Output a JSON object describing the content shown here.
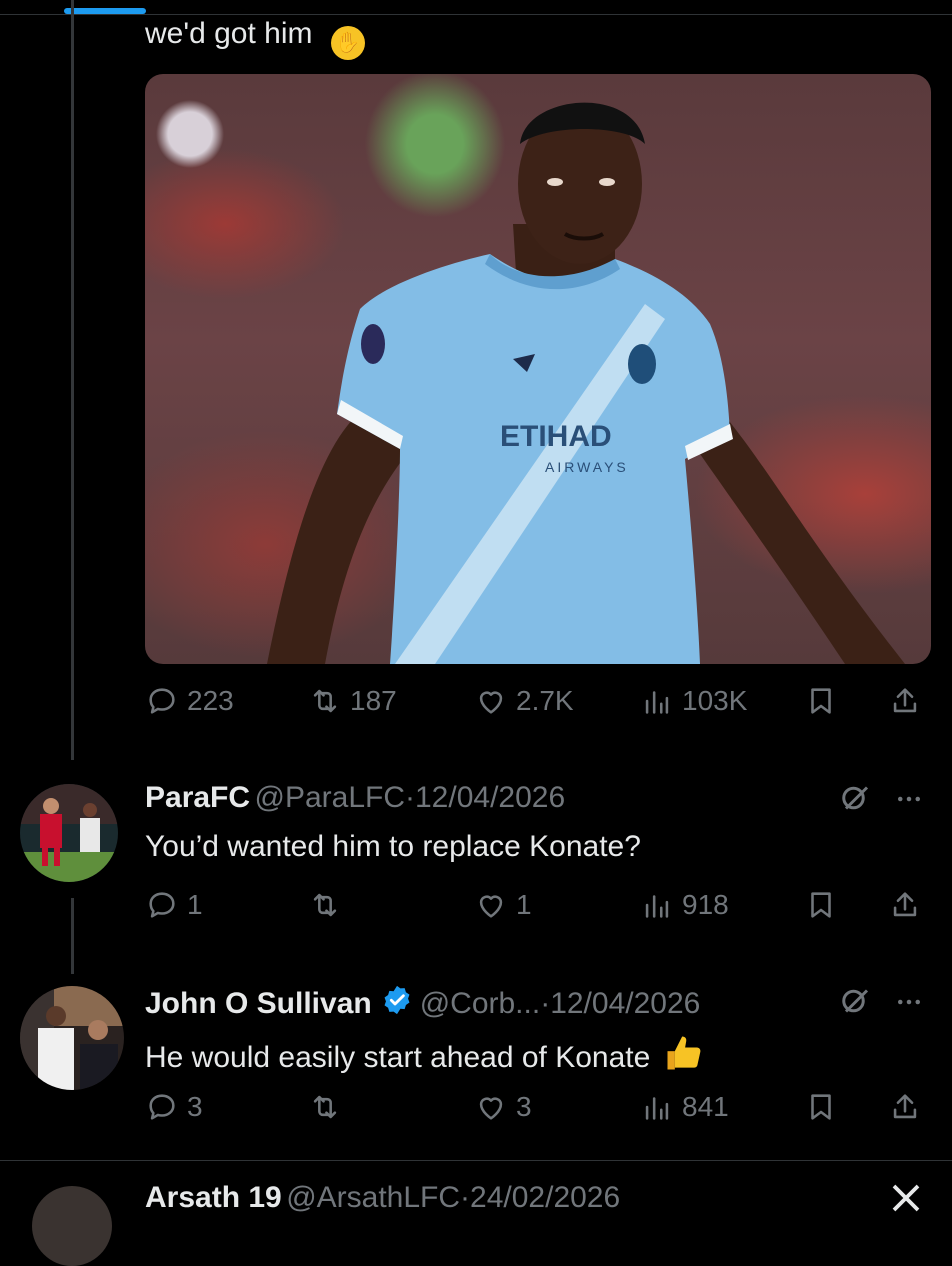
{
  "tweet": {
    "text": "we'd got him",
    "emoji": "face-with-hand-over-mouth",
    "actions": {
      "replies": "223",
      "reposts": "187",
      "likes": "2.7K",
      "views": "103K"
    }
  },
  "replies": [
    {
      "name": "ParaFC",
      "handle": "@ParaLFC",
      "separator": "·",
      "date": "12/04/2026",
      "text": "You’d wanted him to replace Konate?",
      "replies": "1",
      "reposts": "",
      "likes": "1",
      "views": "918"
    },
    {
      "name": "John O Sullivan",
      "verified": true,
      "handle": "@Corb...",
      "separator": "·",
      "date": "12/04/2026",
      "text": "He would easily start ahead of Konate",
      "emoji": "thumbs-up",
      "replies": "3",
      "reposts": "",
      "likes": "3",
      "views": "841"
    },
    {
      "name": "Arsath 19",
      "handle": "@ArsathLFC",
      "separator": "·",
      "date": "24/02/2026"
    }
  ],
  "icons": [
    "reply-icon",
    "repost-icon",
    "like-icon",
    "views-icon",
    "bookmark-icon",
    "share-icon",
    "grok-icon",
    "more-icon",
    "verified-badge-icon",
    "close-icon"
  ],
  "colors": {
    "background": "#000000",
    "text": "#e7e9ea",
    "secondary": "#71767b",
    "accent": "#1d9bf0",
    "divider": "#2f3336"
  }
}
